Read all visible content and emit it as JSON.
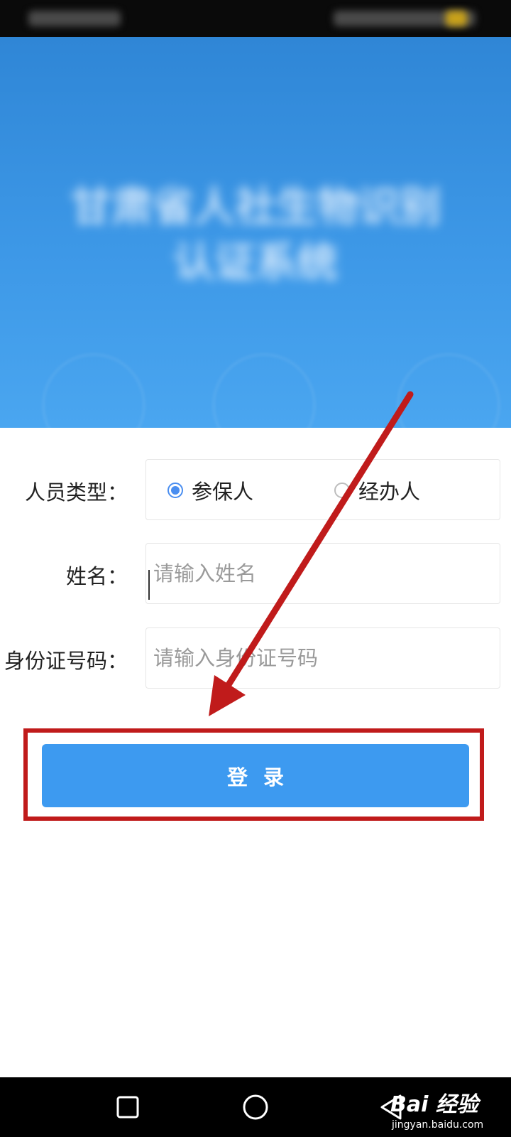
{
  "banner": {
    "title_line1": "甘肃省人社生物识别",
    "title_line2": "认证系统"
  },
  "form": {
    "person_type_label": "人员类型：",
    "person_type_options": [
      "参保人",
      "经办人"
    ],
    "person_type_selected": "参保人",
    "name_label": "姓名：",
    "name_placeholder": "请输入姓名",
    "name_value": "",
    "id_label": "身份证号码：",
    "id_placeholder": "请输入身份证号码",
    "id_value": ""
  },
  "login_button_label": "登录",
  "annotation": {
    "color": "#c01b1b"
  },
  "theme": {
    "accent": "#3d9af0",
    "radio_checked": "#4a8ef0"
  },
  "watermark": {
    "brand": "Bai 经验",
    "url": "jingyan.baidu.com"
  }
}
